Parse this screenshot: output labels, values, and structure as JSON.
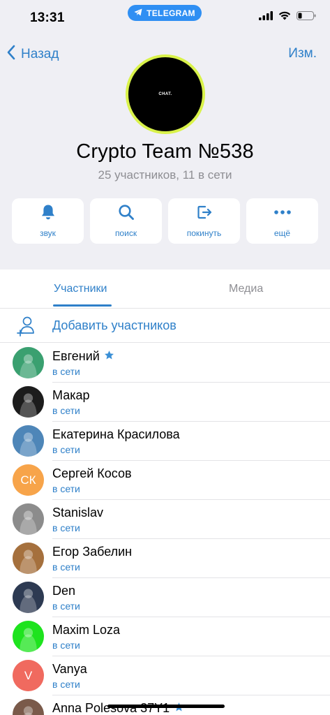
{
  "status_bar": {
    "time": "13:31",
    "app_pill": "TELEGRAM"
  },
  "nav": {
    "back_label": "Назад",
    "edit_label": "Изм."
  },
  "chat": {
    "avatar_text": "CHAT.",
    "title": "Crypto Team №538",
    "subtitle": "25 участников, 11 в сети"
  },
  "actions": [
    {
      "label": "звук",
      "icon": "bell-icon"
    },
    {
      "label": "поиск",
      "icon": "search-icon"
    },
    {
      "label": "покинуть",
      "icon": "leave-icon"
    },
    {
      "label": "ещё",
      "icon": "more-icon"
    }
  ],
  "tabs": {
    "members": "Участники",
    "media": "Медиа"
  },
  "add_members": "Добавить участников",
  "members": [
    {
      "name": "Евгений",
      "status": "в сети",
      "star": true,
      "avatar": "photo",
      "color": "#3aa070"
    },
    {
      "name": "Макар",
      "status": "в сети",
      "star": false,
      "avatar": "photo",
      "color": "#1c1c1c"
    },
    {
      "name": "Екатерина Красилова",
      "status": "в сети",
      "star": false,
      "avatar": "photo",
      "color": "#4e86b8"
    },
    {
      "name": "Сергей Косов",
      "status": "в сети",
      "star": false,
      "avatar": "initials",
      "initials": "СК",
      "color": "#f7a44a"
    },
    {
      "name": "Stanislav",
      "status": "в сети",
      "star": false,
      "avatar": "photo",
      "color": "#8c8c8c"
    },
    {
      "name": "Егор Забелин",
      "status": "в сети",
      "star": false,
      "avatar": "photo",
      "color": "#a5703d"
    },
    {
      "name": "Den",
      "status": "в сети",
      "star": false,
      "avatar": "photo",
      "color": "#2d3a52"
    },
    {
      "name": "Maxim Loza",
      "status": "в сети",
      "star": false,
      "avatar": "photo",
      "color": "#1ee31e"
    },
    {
      "name": "Vanya",
      "status": "в сети",
      "star": false,
      "avatar": "initials",
      "initials": "V",
      "color": "#f06a5f"
    },
    {
      "name": "Anna Polesova 37Y1",
      "status": "",
      "star": true,
      "avatar": "photo",
      "color": "#7a5a4a"
    }
  ],
  "colors": {
    "accent": "#2f80c9",
    "header_bg": "#efeff4",
    "pill_bg": "#2f8ff3",
    "chat_ring": "#d9f24a"
  }
}
